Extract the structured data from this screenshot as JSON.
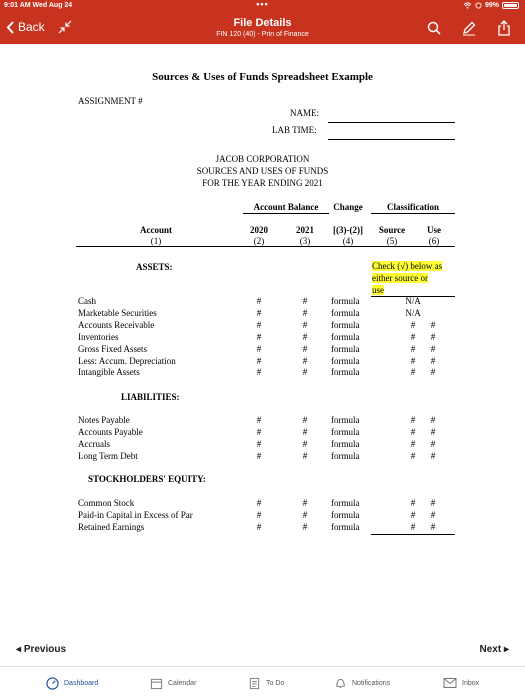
{
  "status": {
    "time": "9:01 AM  Wed Aug 24",
    "dots": "•••",
    "battery": "99%"
  },
  "header": {
    "back_label": "Back",
    "title": "File Details",
    "subtitle": "FIN 120 (40) - Prin of Finance"
  },
  "doc": {
    "title": "Sources & Uses of Funds Spreadsheet Example",
    "assignment": "ASSIGNMENT #",
    "name_label": "NAME:",
    "labtime_label": "LAB TIME:",
    "company": "JACOB CORPORATION",
    "subheading": "SOURCES AND USES OF FUNDS",
    "period": "FOR THE YEAR ENDING 2021",
    "group_headers": {
      "balance": "Account Balance",
      "change": "Change",
      "classification": "Classification"
    },
    "columns": [
      {
        "label": "Account",
        "num": "(1)"
      },
      {
        "label": "2020",
        "num": "(2)"
      },
      {
        "label": "2021",
        "num": "(3)"
      },
      {
        "label": "[(3)-(2)]",
        "num": "(4)"
      },
      {
        "label": "Source",
        "num": "(5)"
      },
      {
        "label": "Use",
        "num": "(6)"
      }
    ],
    "note": [
      "Check (√) below as",
      "either source or",
      "use"
    ],
    "sections": [
      {
        "heading": "ASSETS:",
        "rows": [
          {
            "account": "Cash",
            "y2020": "#",
            "y2021": "#",
            "change": "formula",
            "source": "N/A",
            "use": ""
          },
          {
            "account": "Marketable Securities",
            "y2020": "#",
            "y2021": "#",
            "change": "formula",
            "source": "N/A",
            "use": ""
          },
          {
            "account": "Accounts Receivable",
            "y2020": "#",
            "y2021": "#",
            "change": "formula",
            "source": "#",
            "use": "#"
          },
          {
            "account": "Inventories",
            "y2020": "#",
            "y2021": "#",
            "change": "formula",
            "source": "#",
            "use": "#"
          },
          {
            "account": "Gross Fixed Assets",
            "y2020": "#",
            "y2021": "#",
            "change": "formula",
            "source": "#",
            "use": "#"
          },
          {
            "account": "Less: Accum. Depreciation",
            "y2020": "#",
            "y2021": "#",
            "change": "formula",
            "source": "#",
            "use": "#"
          },
          {
            "account": "Intangible Assets",
            "y2020": "#",
            "y2021": "#",
            "change": "formula",
            "source": "#",
            "use": "#"
          }
        ]
      },
      {
        "heading": "LIABILITIES:",
        "rows": [
          {
            "account": "Notes Payable",
            "y2020": "#",
            "y2021": "#",
            "change": "formula",
            "source": "#",
            "use": "#"
          },
          {
            "account": "Accounts Payable",
            "y2020": "#",
            "y2021": "#",
            "change": "formula",
            "source": "#",
            "use": "#"
          },
          {
            "account": "Accruals",
            "y2020": "#",
            "y2021": "#",
            "change": "formula",
            "source": "#",
            "use": "#"
          },
          {
            "account": "Long Term Debt",
            "y2020": "#",
            "y2021": "#",
            "change": "formula",
            "source": "#",
            "use": "#"
          }
        ]
      },
      {
        "heading": "STOCKHOLDERS' EQUITY:",
        "rows": [
          {
            "account": "Common Stock",
            "y2020": "#",
            "y2021": "#",
            "change": "formula",
            "source": "#",
            "use": "#"
          },
          {
            "account": "Paid-in Capital in Excess of Par",
            "y2020": "#",
            "y2021": "#",
            "change": "formula",
            "source": "#",
            "use": "#"
          },
          {
            "account": "Retained Earnings",
            "y2020": "#",
            "y2021": "#",
            "change": "formula",
            "source": "#",
            "use": "#"
          }
        ]
      }
    ]
  },
  "nav": {
    "previous": "Previous",
    "next": "Next"
  },
  "tabs": [
    {
      "label": "Dashboard",
      "icon": "dashboard-icon"
    },
    {
      "label": "Calendar",
      "icon": "calendar-icon"
    },
    {
      "label": "To Do",
      "icon": "todo-icon"
    },
    {
      "label": "Notifications",
      "icon": "bell-icon"
    },
    {
      "label": "Inbox",
      "icon": "inbox-icon"
    }
  ],
  "colors": {
    "header": "#c8331f",
    "highlight": "#ffff33",
    "active_tab": "#1f4e9b"
  }
}
